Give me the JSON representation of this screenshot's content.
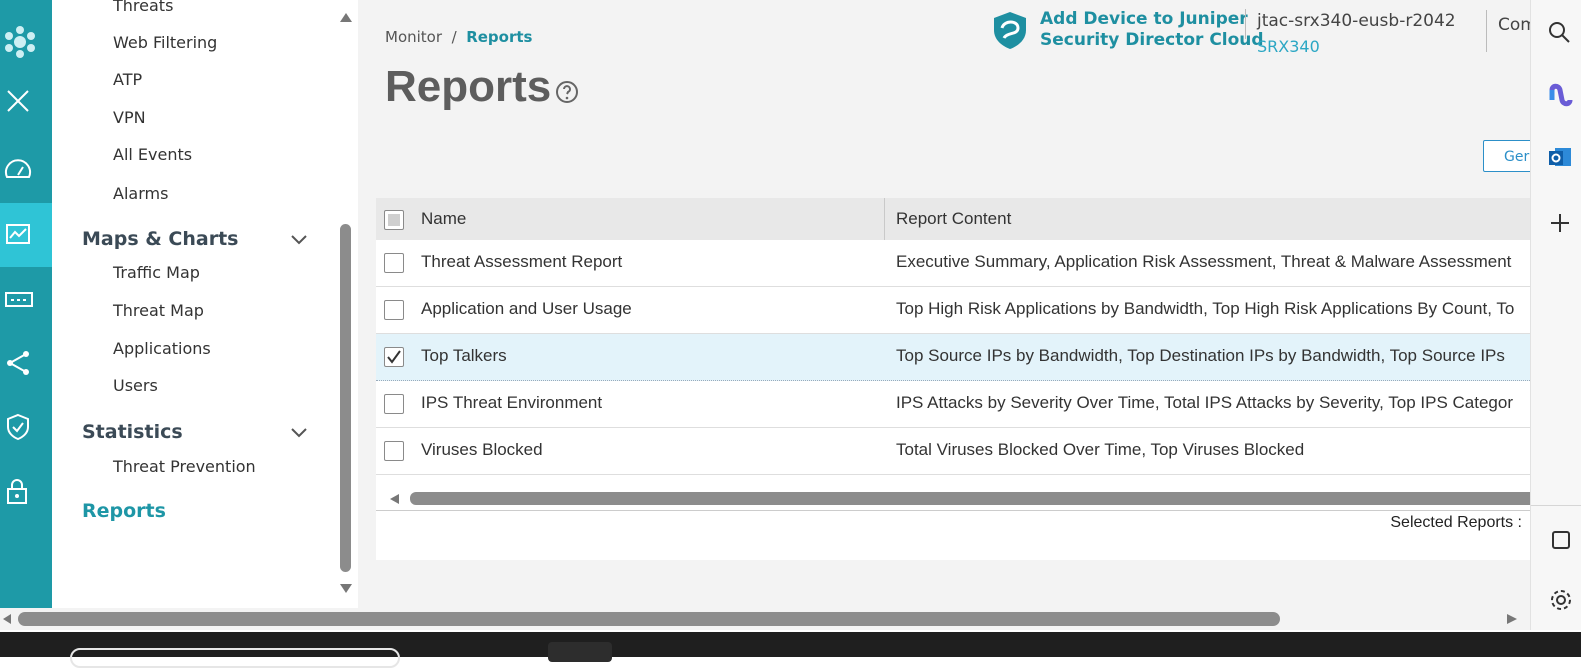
{
  "nav": {
    "items_top": [
      "Threats",
      "Web Filtering",
      "ATP",
      "VPN",
      "All Events",
      "Alarms"
    ],
    "maps_charts": {
      "label": "Maps & Charts",
      "items": [
        "Traffic Map",
        "Threat Map",
        "Applications",
        "Users"
      ]
    },
    "statistics": {
      "label": "Statistics",
      "items": [
        "Threat Prevention"
      ]
    },
    "reports_label": "Reports"
  },
  "header": {
    "promo_line1": "Add Device to Juniper",
    "promo_line2": "Security Director Cloud",
    "device_name": "jtac-srx340-eusb-r2042",
    "device_model": "SRX340",
    "extra_text": "Com"
  },
  "page": {
    "breadcrumb_root": "Monitor",
    "breadcrumb_sep": "/",
    "breadcrumb_current": "Reports",
    "title": "Reports",
    "generate_label": "Ger"
  },
  "table": {
    "columns": [
      "Name",
      "Report Content"
    ],
    "rows": [
      {
        "name": "Threat Assessment Report",
        "content": "Executive Summary, Application Risk Assessment, Threat & Malware Assessment",
        "checked": false
      },
      {
        "name": "Application and User Usage",
        "content": "Top High Risk Applications by Bandwidth, Top High Risk Applications By Count, To",
        "checked": false
      },
      {
        "name": "Top Talkers",
        "content": "Top Source IPs by Bandwidth, Top Destination IPs by Bandwidth, Top Source IPs",
        "checked": true
      },
      {
        "name": "IPS Threat Environment",
        "content": "IPS Attacks by Severity Over Time, Total IPS Attacks by Severity, Top IPS Categor",
        "checked": false
      },
      {
        "name": "Viruses Blocked",
        "content": "Total Viruses Blocked Over Time, Top Viruses Blocked",
        "checked": false
      }
    ],
    "selected_reports_label": "Selected Reports :"
  },
  "colors": {
    "rail": "#1e9aa7",
    "rail_active": "#2fc4d6",
    "accent": "#1e96a6",
    "selected_row": "#e3f3fa"
  },
  "icons": {
    "rail": [
      "juniper-logo-icon",
      "close-icon",
      "dashboard-icon",
      "monitor-icon",
      "device-icon",
      "network-icon",
      "security-policy-icon",
      "lock-icon"
    ],
    "right_sidebar": [
      "search-icon",
      "copilot-icon",
      "outlook-icon",
      "plus-icon",
      "window-icon",
      "settings-icon"
    ]
  }
}
